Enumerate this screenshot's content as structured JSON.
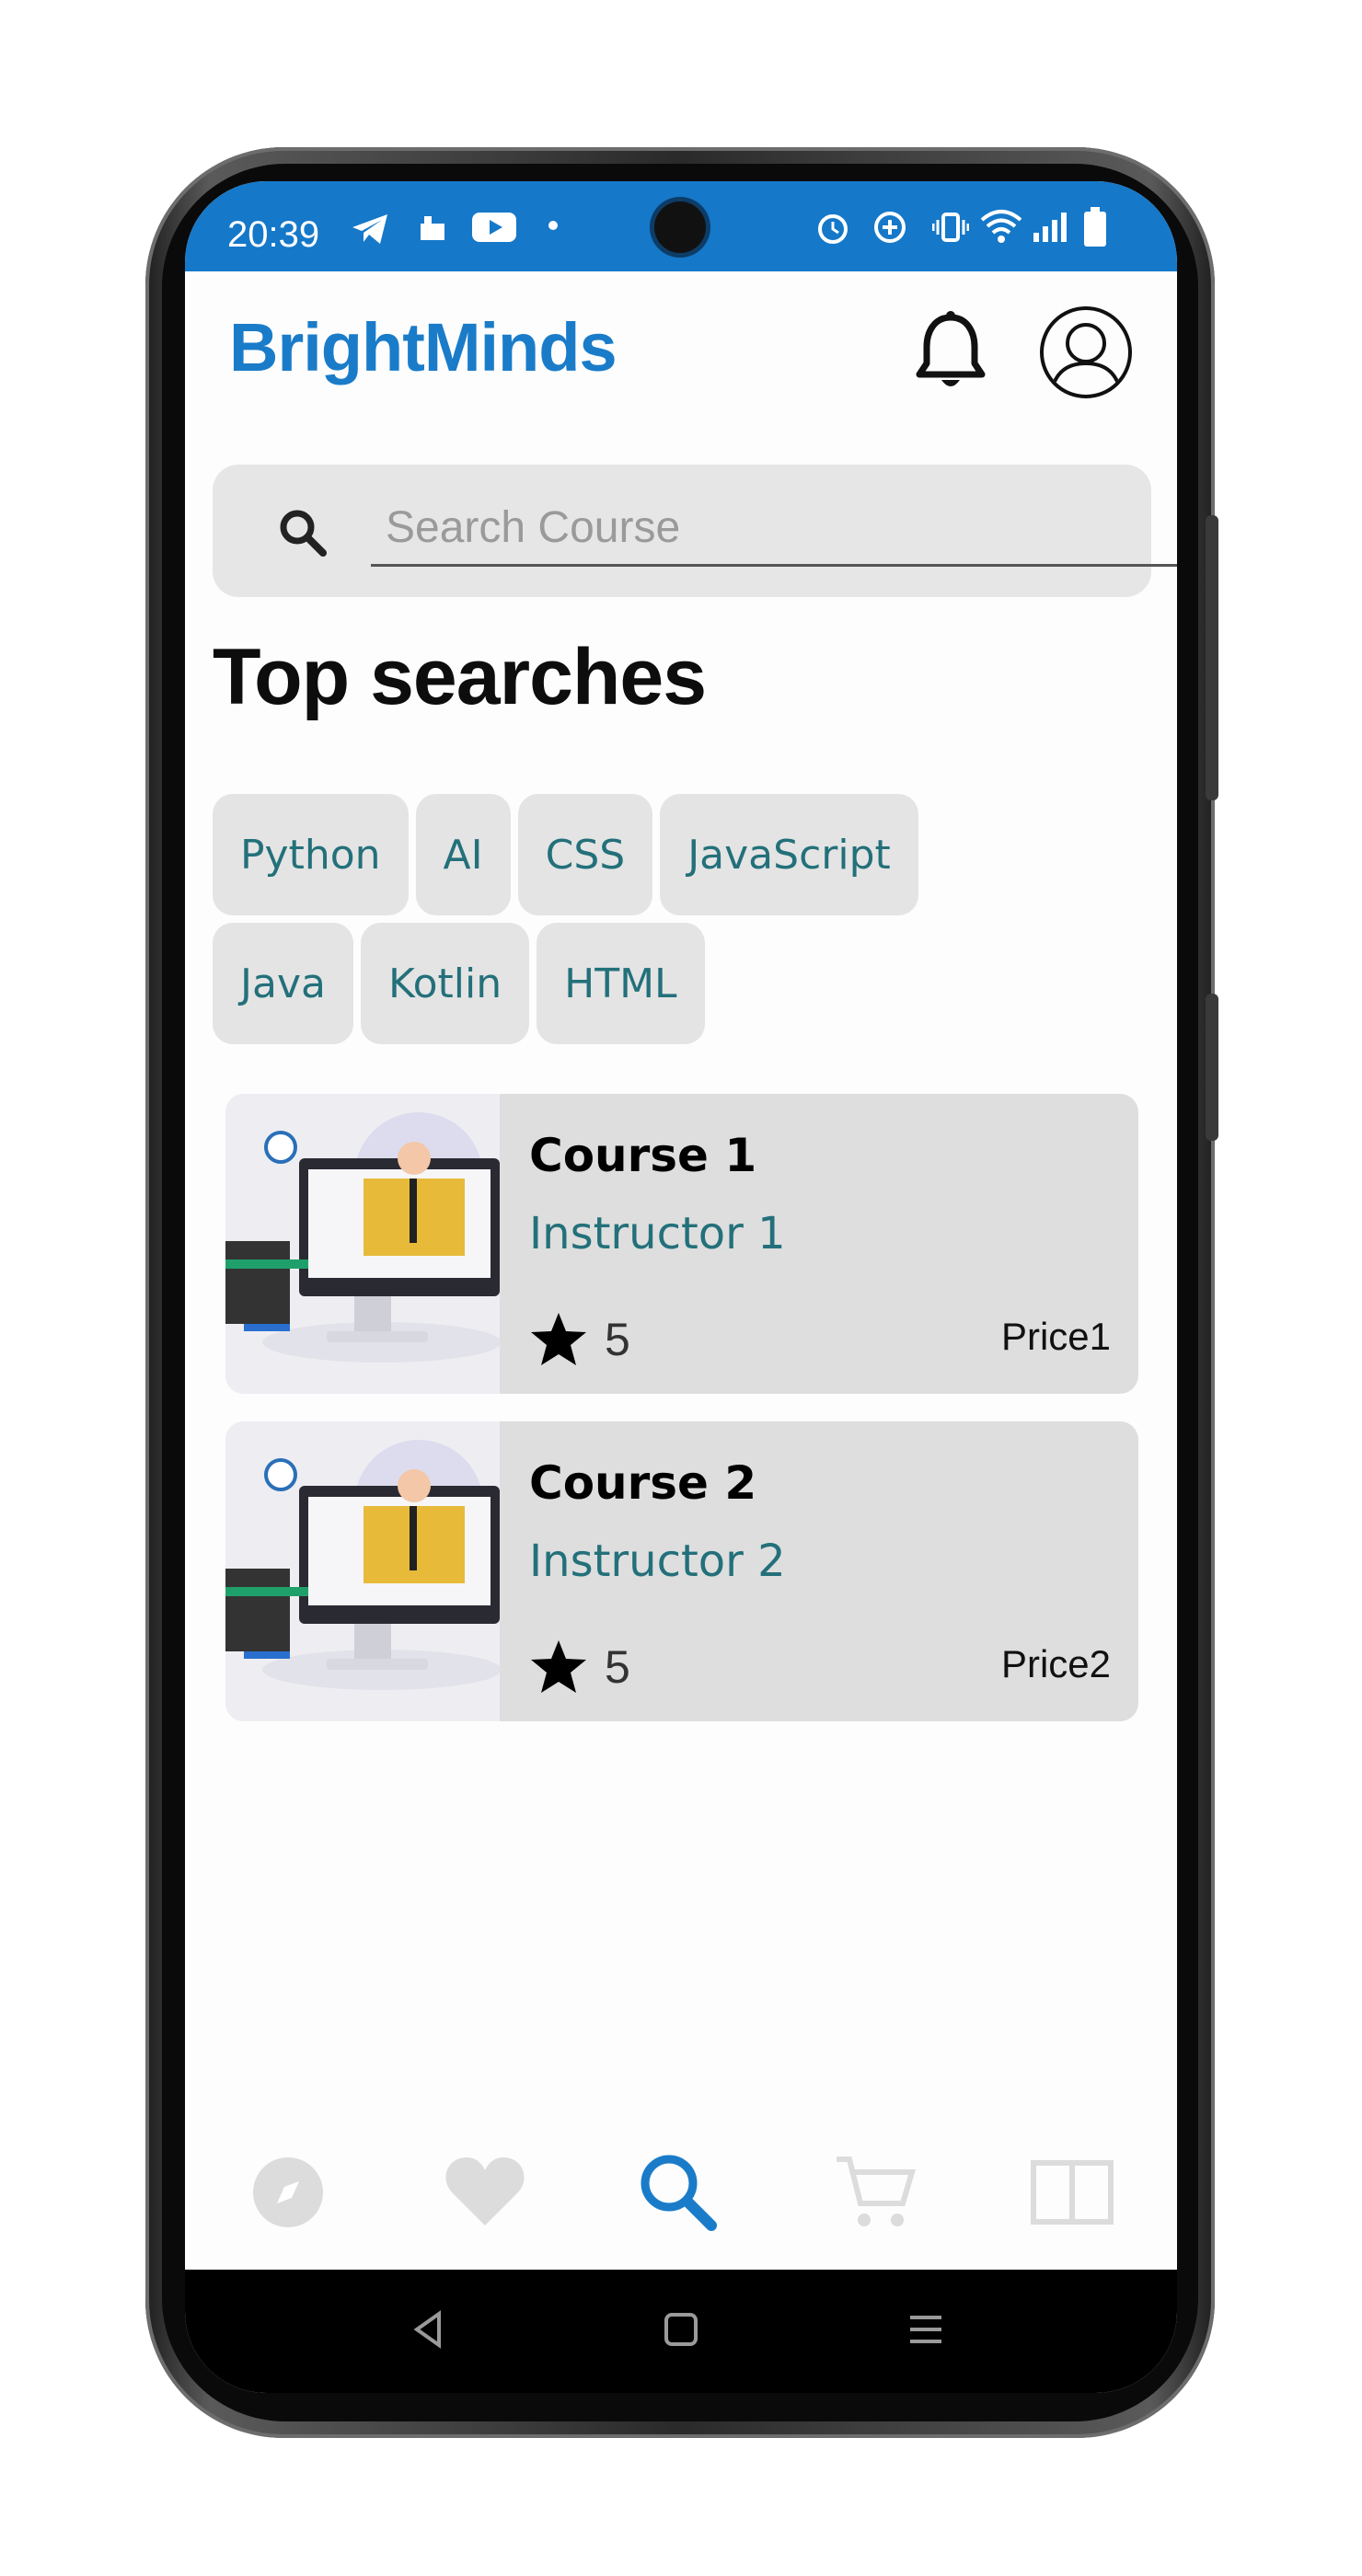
{
  "status_bar": {
    "time": "20:39",
    "icons": [
      "telegram-icon",
      "app-notification-icon",
      "youtube-icon",
      "dot-icon",
      "alarm-icon",
      "data-saver-icon",
      "vibrate-icon",
      "wifi-icon",
      "signal-icon",
      "battery-icon"
    ]
  },
  "header": {
    "brand": "BrightMinds",
    "icons": [
      "bell-icon",
      "profile-icon"
    ]
  },
  "search": {
    "placeholder": "Search Course",
    "value": ""
  },
  "top_searches": {
    "title": "Top searches",
    "chips": [
      "Python",
      "AI",
      "CSS",
      "JavaScript",
      "Java",
      "Kotlin",
      "HTML"
    ]
  },
  "courses": [
    {
      "title": "Course 1",
      "instructor": "Instructor 1",
      "rating": "5",
      "price": "Price1"
    },
    {
      "title": "Course 2",
      "instructor": "Instructor 2",
      "rating": "5",
      "price": "Price2"
    }
  ],
  "bottom_nav": {
    "items": [
      {
        "icon": "compass-icon",
        "active": false
      },
      {
        "icon": "heart-icon",
        "active": false
      },
      {
        "icon": "search-icon",
        "active": true
      },
      {
        "icon": "cart-icon",
        "active": false
      },
      {
        "icon": "book-icon",
        "active": false
      }
    ]
  },
  "colors": {
    "brand": "#1a7cc9",
    "status_bar": "#1578c9",
    "chip_text": "#23707a",
    "inactive_nav": "#d8d8d8"
  }
}
